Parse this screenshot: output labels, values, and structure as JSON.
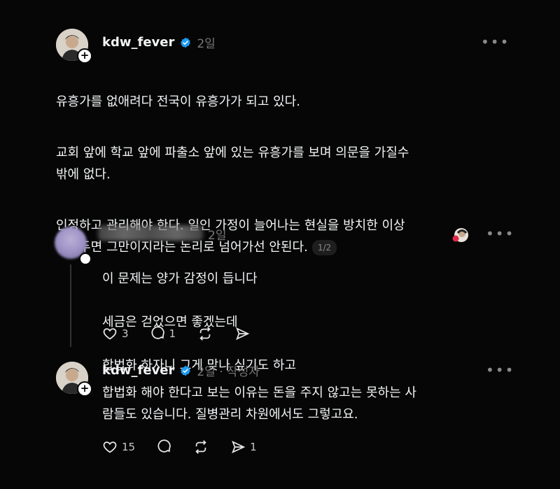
{
  "post": {
    "username": "kdw_fever",
    "time": "2일",
    "paragraphs": [
      "유흥가를 없애려다 전국이 유흥가가 되고 있다.",
      "교회 앞에 학교 앞에 파출소 앞에 있는 유흥가를 보며 의문을 가질수\n밖에 없다.",
      "인정하고 관리해야 한다. 일인 가정이 늘어나는 현실을 방치한 이상\n덮어두면 그만이지라는 논리로 넘어가선 안된다."
    ],
    "pager": "1/2"
  },
  "reply": {
    "time": "2일",
    "lines": [
      "이 문제는 양가 감정이 듭니다",
      "세금은 걷었으면 좋겠는데",
      "합법화 하자니 그게 맞나 싶기도 하고"
    ],
    "likes": "3",
    "comments": "1"
  },
  "author_reply": {
    "username": "kdw_fever",
    "time": "2일 · 작성자",
    "text": "합법화 해야 한다고 보는 이유는 돈을 주지 않고는 못하는 사\n람들도 있습니다. 질병관리 차원에서도 그렇고요.",
    "likes": "15",
    "shares": "1"
  },
  "icons": {
    "more": "ellipsis-icon",
    "like": "heart-icon",
    "comment": "comment-bubble-icon",
    "repost": "repost-icon",
    "share": "send-icon",
    "verified": "verified-badge-icon"
  },
  "colors": {
    "background": "#060606",
    "text": "#f3f5f7",
    "muted": "#777777",
    "verified": "#1d9bf0"
  }
}
